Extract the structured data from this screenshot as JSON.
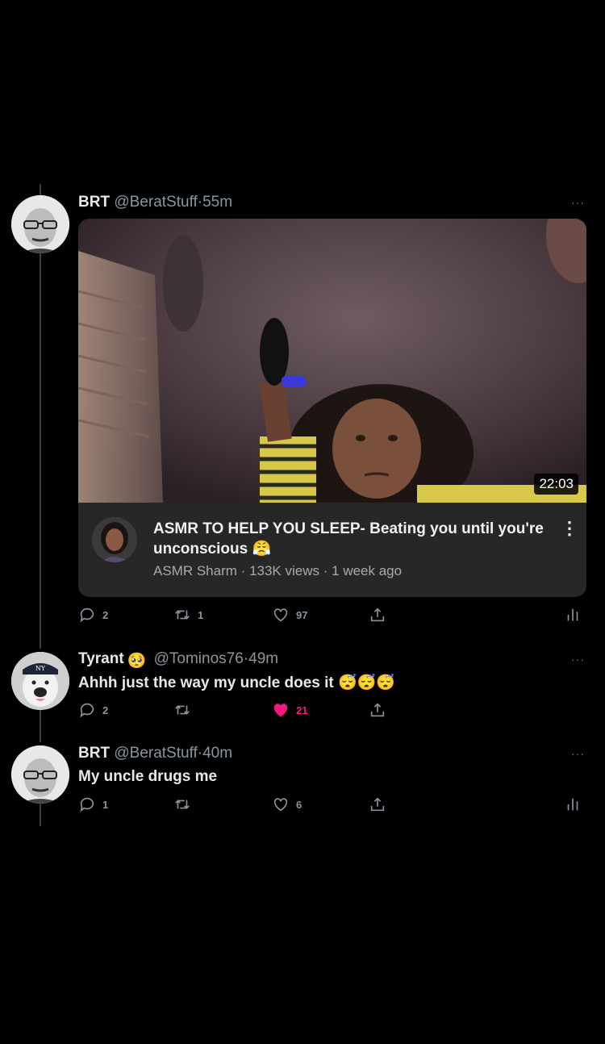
{
  "thread": {
    "tweets": [
      {
        "name": "BRT",
        "handle": "@BeratStuff",
        "time": "55m",
        "more": "···",
        "video": {
          "duration": "22:03",
          "title": "ASMR TO HELP YOU SLEEP- Beating you until you're unconscious",
          "title_emoji": "😤",
          "channel": "ASMR Sharm",
          "views": "133K views",
          "age": "1 week ago",
          "menu": "⋮"
        },
        "replies": "2",
        "retweets": "1",
        "likes": "97"
      },
      {
        "name": "Tyrant",
        "name_emoji": "🥺",
        "handle": "@Tominos76",
        "time": "49m",
        "more": "···",
        "text": "Ahhh just the way my uncle does it",
        "text_emojis": "😴😴😴",
        "replies": "2",
        "retweets": "",
        "likes": "21",
        "liked": true
      },
      {
        "name": "BRT",
        "handle": "@BeratStuff",
        "time": "40m",
        "more": "···",
        "text": "My uncle drugs me",
        "replies": "1",
        "retweets": "",
        "likes": "6"
      }
    ]
  },
  "colors": {
    "background": "#000000",
    "text": "#e7e9ea",
    "muted": "#8b949e",
    "like": "#f91880",
    "card": "#272727"
  },
  "icons": [
    "reply-icon",
    "retweet-icon",
    "like-icon",
    "share-icon",
    "analytics-icon",
    "more-icon"
  ]
}
